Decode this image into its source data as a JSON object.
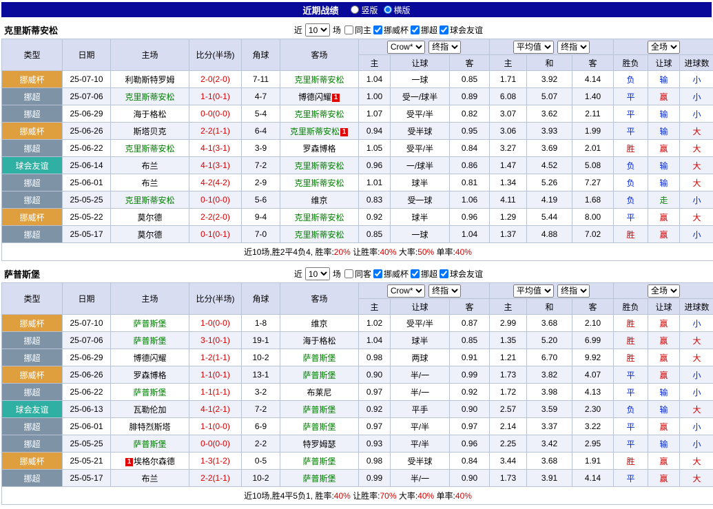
{
  "topbar": {
    "title": "近期战绩",
    "vertical_label": "竖版",
    "horizontal_label": "横版",
    "selected": "横版"
  },
  "filter": {
    "near_label": "近",
    "count": "10",
    "games_label": "场"
  },
  "table_header": {
    "cols": [
      "类型",
      "日期",
      "主场",
      "比分(半场)",
      "角球",
      "客场"
    ],
    "odds_group1": {
      "selects": [
        "Crow*",
        "终指"
      ],
      "cols": [
        "主",
        "让球",
        "客"
      ]
    },
    "odds_group2": {
      "selects": [
        "平均值",
        "终指"
      ],
      "cols": [
        "主",
        "和",
        "客"
      ]
    },
    "odds_group3": {
      "selects": [
        "全场"
      ],
      "cols": [
        "胜负",
        "让球",
        "进球数"
      ]
    }
  },
  "type_colors": {
    "挪威杯": "#df9f3e",
    "挪超": "#7e93a5",
    "球会友谊": "#2fb0a3"
  },
  "result_colors": {
    "胜": "#d40000",
    "平": "#0026d8",
    "负": "#0026d8",
    "赢": "#d40000",
    "输": "#0026d8",
    "走": "#009000",
    "大": "#d40000",
    "小": "#0026d8"
  },
  "sections": [
    {
      "team": "克里斯蒂安松",
      "filters": [
        {
          "label": "同主",
          "checked": false
        },
        {
          "label": "挪威杯",
          "checked": true
        },
        {
          "label": "挪超",
          "checked": true
        },
        {
          "label": "球会友谊",
          "checked": true
        }
      ],
      "rows": [
        {
          "type": "挪威杯",
          "date": "25-07-10",
          "home": "利勒斯特罗姆",
          "score": "2-0(2-0)",
          "corner": "7-11",
          "away": "克里斯蒂安松",
          "away_green": true,
          "o1": "1.04",
          "o2": "一球",
          "o3": "0.85",
          "a1": "1.71",
          "a2": "3.92",
          "a3": "4.14",
          "r1": "负",
          "r2": "输",
          "r3": "小"
        },
        {
          "type": "挪超",
          "date": "25-07-06",
          "home": "克里斯蒂安松",
          "home_green": true,
          "score": "1-1(0-1)",
          "corner": "4-7",
          "away": "博德闪耀",
          "away_card": "1",
          "o1": "1.00",
          "o2": "受一/球半",
          "o3": "0.89",
          "a1": "6.08",
          "a2": "5.07",
          "a3": "1.40",
          "r1": "平",
          "r2": "赢",
          "r3": "小"
        },
        {
          "type": "挪超",
          "date": "25-06-29",
          "home": "海于格松",
          "score": "0-0(0-0)",
          "corner": "5-4",
          "away": "克里斯蒂安松",
          "away_green": true,
          "o1": "1.07",
          "o2": "受平/半",
          "o3": "0.82",
          "a1": "3.07",
          "a2": "3.62",
          "a3": "2.11",
          "r1": "平",
          "r2": "输",
          "r3": "小"
        },
        {
          "type": "挪威杯",
          "date": "25-06-26",
          "home": "斯塔贝克",
          "score": "2-2(1-1)",
          "corner": "6-4",
          "away": "克里斯蒂安松",
          "away_green": true,
          "away_card": "1",
          "o1": "0.94",
          "o2": "受半球",
          "o3": "0.95",
          "a1": "3.06",
          "a2": "3.93",
          "a3": "1.99",
          "r1": "平",
          "r2": "输",
          "r3": "大"
        },
        {
          "type": "挪超",
          "date": "25-06-22",
          "home": "克里斯蒂安松",
          "home_green": true,
          "score": "4-1(3-1)",
          "corner": "3-9",
          "away": "罗森博格",
          "o1": "1.05",
          "o2": "受平/半",
          "o3": "0.84",
          "a1": "3.27",
          "a2": "3.69",
          "a3": "2.01",
          "r1": "胜",
          "r2": "赢",
          "r3": "大"
        },
        {
          "type": "球会友谊",
          "date": "25-06-14",
          "home": "布兰",
          "score": "4-1(3-1)",
          "corner": "7-2",
          "away": "克里斯蒂安松",
          "away_green": true,
          "o1": "0.96",
          "o2": "一/球半",
          "o3": "0.86",
          "a1": "1.47",
          "a2": "4.52",
          "a3": "5.08",
          "r1": "负",
          "r2": "输",
          "r3": "大"
        },
        {
          "type": "挪超",
          "date": "25-06-01",
          "home": "布兰",
          "score": "4-2(4-2)",
          "corner": "2-9",
          "away": "克里斯蒂安松",
          "away_green": true,
          "o1": "1.01",
          "o2": "球半",
          "o3": "0.81",
          "a1": "1.34",
          "a2": "5.26",
          "a3": "7.27",
          "r1": "负",
          "r2": "输",
          "r3": "大"
        },
        {
          "type": "挪超",
          "date": "25-05-25",
          "home": "克里斯蒂安松",
          "home_green": true,
          "score": "0-1(0-0)",
          "corner": "5-6",
          "away": "维京",
          "o1": "0.83",
          "o2": "受一球",
          "o3": "1.06",
          "a1": "4.11",
          "a2": "4.19",
          "a3": "1.68",
          "r1": "负",
          "r2": "走",
          "r3": "小"
        },
        {
          "type": "挪威杯",
          "date": "25-05-22",
          "home": "莫尔德",
          "score": "2-2(2-0)",
          "corner": "9-4",
          "away": "克里斯蒂安松",
          "away_green": true,
          "o1": "0.92",
          "o2": "球半",
          "o3": "0.96",
          "a1": "1.29",
          "a2": "5.44",
          "a3": "8.00",
          "r1": "平",
          "r2": "赢",
          "r3": "大"
        },
        {
          "type": "挪超",
          "date": "25-05-17",
          "home": "莫尔德",
          "score": "0-1(0-1)",
          "corner": "7-0",
          "away": "克里斯蒂安松",
          "away_green": true,
          "o1": "0.85",
          "o2": "一球",
          "o3": "1.04",
          "a1": "1.37",
          "a2": "4.88",
          "a3": "7.02",
          "r1": "胜",
          "r2": "赢",
          "r3": "小"
        }
      ],
      "summary": {
        "prefix": "近10场,胜2平4负4,",
        "stats": [
          [
            "胜率:",
            "20%"
          ],
          [
            "让胜率:",
            "40%"
          ],
          [
            "大率:",
            "50%"
          ],
          [
            "单率:",
            "40%"
          ]
        ]
      }
    },
    {
      "team": "萨普斯堡",
      "filters": [
        {
          "label": "同客",
          "checked": false
        },
        {
          "label": "挪威杯",
          "checked": true
        },
        {
          "label": "挪超",
          "checked": true
        },
        {
          "label": "球会友谊",
          "checked": true
        }
      ],
      "rows": [
        {
          "type": "挪威杯",
          "date": "25-07-10",
          "home": "萨普斯堡",
          "home_green": true,
          "score": "1-0(0-0)",
          "corner": "1-8",
          "away": "维京",
          "o1": "1.02",
          "o2": "受平/半",
          "o3": "0.87",
          "a1": "2.99",
          "a2": "3.68",
          "a3": "2.10",
          "r1": "胜",
          "r2": "赢",
          "r3": "小"
        },
        {
          "type": "挪超",
          "date": "25-07-06",
          "home": "萨普斯堡",
          "home_green": true,
          "score": "3-1(0-1)",
          "corner": "19-1",
          "away": "海于格松",
          "o1": "1.04",
          "o2": "球半",
          "o3": "0.85",
          "a1": "1.35",
          "a2": "5.20",
          "a3": "6.99",
          "r1": "胜",
          "r2": "赢",
          "r3": "大"
        },
        {
          "type": "挪超",
          "date": "25-06-29",
          "home": "博德闪耀",
          "score": "1-2(1-1)",
          "corner": "10-2",
          "away": "萨普斯堡",
          "away_green": true,
          "o1": "0.98",
          "o2": "两球",
          "o3": "0.91",
          "a1": "1.21",
          "a2": "6.70",
          "a3": "9.92",
          "r1": "胜",
          "r2": "赢",
          "r3": "大"
        },
        {
          "type": "挪威杯",
          "date": "25-06-26",
          "home": "罗森博格",
          "score": "1-1(0-1)",
          "corner": "13-1",
          "away": "萨普斯堡",
          "away_green": true,
          "o1": "0.90",
          "o2": "半/一",
          "o3": "0.99",
          "a1": "1.73",
          "a2": "3.82",
          "a3": "4.07",
          "r1": "平",
          "r2": "赢",
          "r3": "小"
        },
        {
          "type": "挪超",
          "date": "25-06-22",
          "home": "萨普斯堡",
          "home_green": true,
          "score": "1-1(1-1)",
          "corner": "3-2",
          "away": "布莱尼",
          "o1": "0.97",
          "o2": "半/一",
          "o3": "0.92",
          "a1": "1.72",
          "a2": "3.98",
          "a3": "4.13",
          "r1": "平",
          "r2": "输",
          "r3": "小"
        },
        {
          "type": "球会友谊",
          "date": "25-06-13",
          "home": "瓦勒伦加",
          "score": "4-1(2-1)",
          "corner": "7-2",
          "away": "萨普斯堡",
          "away_green": true,
          "o1": "0.92",
          "o2": "平手",
          "o3": "0.90",
          "a1": "2.57",
          "a2": "3.59",
          "a3": "2.30",
          "r1": "负",
          "r2": "输",
          "r3": "大"
        },
        {
          "type": "挪超",
          "date": "25-06-01",
          "home": "腓特烈斯塔",
          "score": "1-1(0-0)",
          "corner": "6-9",
          "away": "萨普斯堡",
          "away_green": true,
          "o1": "0.97",
          "o2": "平/半",
          "o3": "0.97",
          "a1": "2.14",
          "a2": "3.37",
          "a3": "3.22",
          "r1": "平",
          "r2": "赢",
          "r3": "小"
        },
        {
          "type": "挪超",
          "date": "25-05-25",
          "home": "萨普斯堡",
          "home_green": true,
          "score": "0-0(0-0)",
          "corner": "2-2",
          "away": "特罗姆瑟",
          "o1": "0.93",
          "o2": "平/半",
          "o3": "0.96",
          "a1": "2.25",
          "a2": "3.42",
          "a3": "2.95",
          "r1": "平",
          "r2": "输",
          "r3": "小"
        },
        {
          "type": "挪威杯",
          "date": "25-05-21",
          "home": "埃格尔森德",
          "home_card": "1",
          "home_card_left": true,
          "score": "1-3(1-2)",
          "corner": "0-5",
          "away": "萨普斯堡",
          "away_green": true,
          "o1": "0.98",
          "o2": "受半球",
          "o3": "0.84",
          "a1": "3.44",
          "a2": "3.68",
          "a3": "1.91",
          "r1": "胜",
          "r2": "赢",
          "r3": "大"
        },
        {
          "type": "挪超",
          "date": "25-05-17",
          "home": "布兰",
          "score": "2-2(1-1)",
          "corner": "10-2",
          "away": "萨普斯堡",
          "away_green": true,
          "o1": "0.99",
          "o2": "半/一",
          "o3": "0.90",
          "a1": "1.73",
          "a2": "3.91",
          "a3": "4.14",
          "r1": "平",
          "r2": "赢",
          "r3": "大"
        }
      ],
      "summary": {
        "prefix": "近10场,胜4平5负1,",
        "stats": [
          [
            "胜率:",
            "40%"
          ],
          [
            "让胜率:",
            "70%"
          ],
          [
            "大率:",
            "40%"
          ],
          [
            "单率:",
            "40%"
          ]
        ]
      }
    }
  ]
}
